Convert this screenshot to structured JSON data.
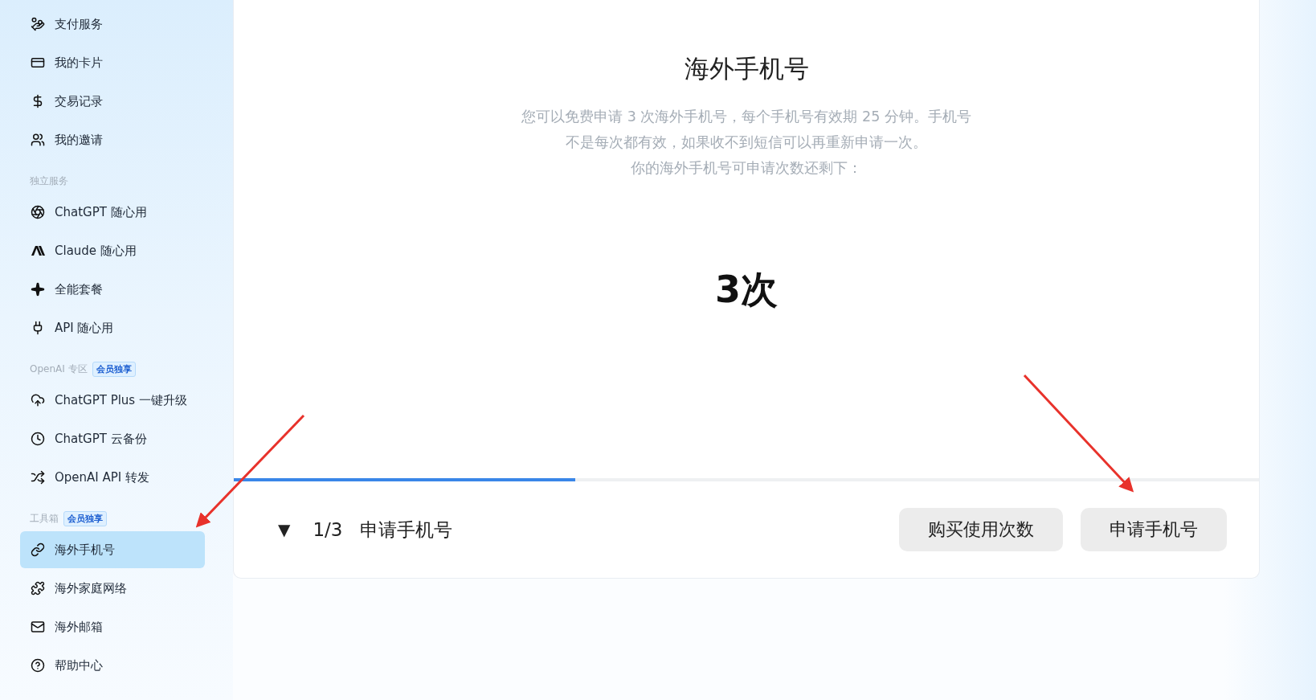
{
  "sidebar": {
    "sections": [
      {
        "items": [
          {
            "label": "支付服务",
            "selected": false
          },
          {
            "label": "我的卡片",
            "selected": false
          },
          {
            "label": "交易记录",
            "selected": false
          },
          {
            "label": "我的邀请",
            "selected": false
          }
        ]
      },
      {
        "header": "独立服务",
        "items": [
          {
            "label": "ChatGPT 随心用",
            "selected": false
          },
          {
            "label": "Claude 随心用",
            "selected": false
          },
          {
            "label": "全能套餐",
            "selected": false
          },
          {
            "label": "API 随心用",
            "selected": false
          }
        ]
      },
      {
        "header": "OpenAI 专区",
        "badge": "会员独享",
        "items": [
          {
            "label": "ChatGPT Plus 一键升级",
            "selected": false
          },
          {
            "label": "ChatGPT 云备份",
            "selected": false
          },
          {
            "label": "OpenAI API 转发",
            "selected": false
          }
        ]
      },
      {
        "header": "工具箱",
        "badge": "会员独享",
        "items": [
          {
            "label": "海外手机号",
            "selected": true
          },
          {
            "label": "海外家庭网络",
            "selected": false
          },
          {
            "label": "海外邮箱",
            "selected": false
          },
          {
            "label": "帮助中心",
            "selected": false
          }
        ]
      }
    ]
  },
  "main": {
    "title": "海外手机号",
    "description": [
      "您可以免费申请 3 次海外手机号，每个手机号有效期 25 分钟。手机号",
      "不是每次都有效，如果收不到短信可以再重新申请一次。",
      "你的海外手机号可申请次数还剩下："
    ],
    "count": "3次",
    "progress": {
      "level": 0.333
    },
    "footer": {
      "toggle": "▼",
      "step": "1/3",
      "step_label": "申请手机号",
      "buttons": [
        "购买使用次数",
        "申请手机号"
      ]
    }
  }
}
